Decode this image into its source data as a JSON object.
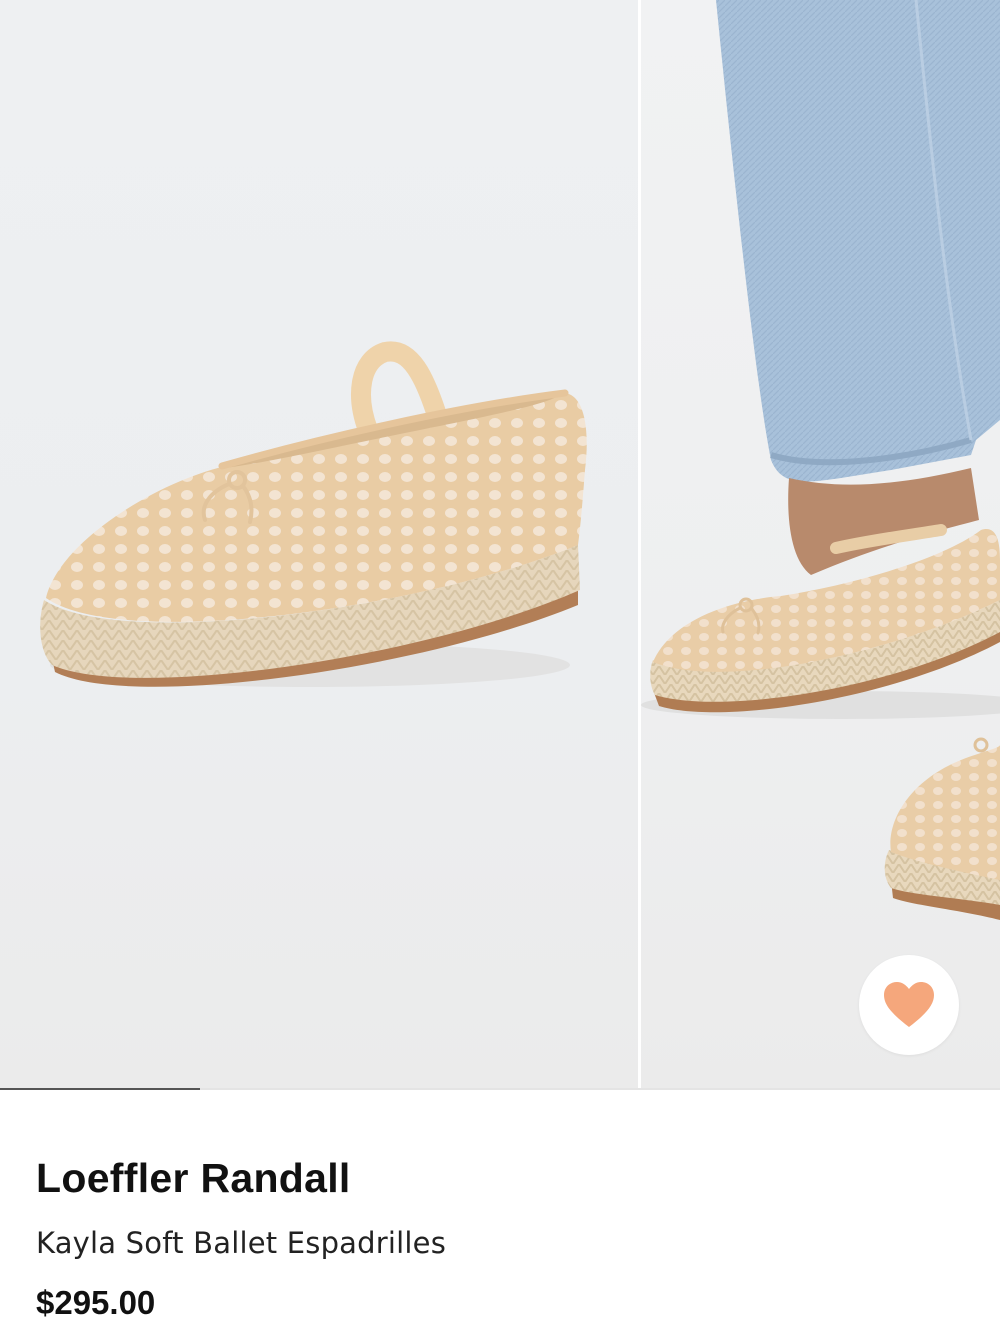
{
  "product": {
    "brand": "Loeffler Randall",
    "name": "Kayla Soft Ballet Espadrilles",
    "price": "$295.00"
  },
  "gallery": {
    "images": [
      {
        "view": "single shoe, three-quarter view"
      },
      {
        "view": "on model with jeans"
      }
    ],
    "progress_fraction": 0.2
  },
  "favorite": {
    "icon": "heart-icon",
    "color": "#F5A77C"
  },
  "colors": {
    "shoe": "#EDD2AE",
    "jute": "#E7D8BE",
    "sole": "#B07C53",
    "denim": "#A9C2DB"
  }
}
